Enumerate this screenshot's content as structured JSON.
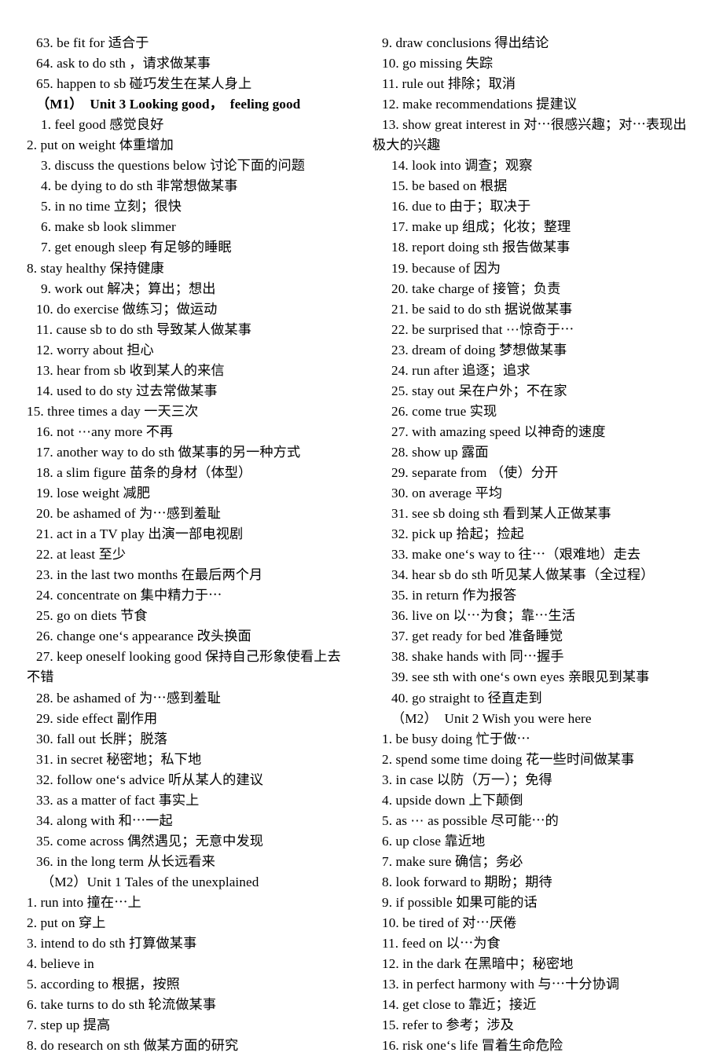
{
  "document": {
    "title": "English phrases study list",
    "left_column": [
      {
        "text": "63. be fit for 适合于",
        "indent": 2
      },
      {
        "text": "64. ask to do sth ，请求做某事",
        "indent": 2
      },
      {
        "text": "65. happen to sb 碰巧发生在某人身上",
        "indent": 2
      },
      {
        "text": "（M1）  Unit 3 Looking good，  feeling good",
        "indent": 2,
        "style": "header-bold"
      },
      {
        "text": "1. feel good 感觉良好",
        "indent": 3
      },
      {
        "text": "2. put on weight 体重增加",
        "indent": 0
      },
      {
        "text": "3. discuss the questions below 讨论下面的问题",
        "indent": 3
      },
      {
        "text": "4. be dying to do sth 非常想做某事",
        "indent": 3
      },
      {
        "text": "5. in no time 立刻；很快",
        "indent": 3
      },
      {
        "text": "6. make sb look slimmer",
        "indent": 3
      },
      {
        "text": "7. get enough sleep 有足够的睡眠",
        "indent": 3
      },
      {
        "text": "8. stay healthy 保持健康",
        "indent": 0
      },
      {
        "text": "9. work out 解决；算出；想出",
        "indent": 3
      },
      {
        "text": "10. do exercise 做练习；做运动",
        "indent": 2
      },
      {
        "text": "11. cause sb to do sth 导致某人做某事",
        "indent": 2
      },
      {
        "text": "12. worry about 担心",
        "indent": 2
      },
      {
        "text": "13. hear from sb 收到某人的来信",
        "indent": 2
      },
      {
        "text": "14. used to do sty 过去常做某事",
        "indent": 2
      },
      {
        "text": "15. three times a day 一天三次",
        "indent": 0
      },
      {
        "text": "16. not ⋯any more 不再",
        "indent": 2
      },
      {
        "text": "17. another way to do sth 做某事的另一种方式",
        "indent": 2
      },
      {
        "text": "18. a slim figure 苗条的身材（体型）",
        "indent": 2
      },
      {
        "text": "19. lose weight 减肥",
        "indent": 2
      },
      {
        "text": "20. be ashamed of 为⋯感到羞耻",
        "indent": 2
      },
      {
        "text": "21. act in a TV play 出演一部电视剧",
        "indent": 2
      },
      {
        "text": "22. at least 至少",
        "indent": 2
      },
      {
        "text": "23. in the last two months 在最后两个月",
        "indent": 2
      },
      {
        "text": "24. concentrate on 集中精力于⋯",
        "indent": 2
      },
      {
        "text": "25. go on diets 节食",
        "indent": 2
      },
      {
        "text": "26. change one‘s appearance 改头换面",
        "indent": 2
      },
      {
        "text": "27. keep oneself looking good 保持自己形象使看上去",
        "indent": 2
      },
      {
        "text": "不错",
        "indent": 0,
        "style": "wrap"
      },
      {
        "text": "28. be ashamed of 为⋯感到羞耻",
        "indent": 2
      },
      {
        "text": "29. side effect 副作用",
        "indent": 2
      },
      {
        "text": "30. fall out 长胖；脱落",
        "indent": 2
      },
      {
        "text": "31. in secret 秘密地；私下地",
        "indent": 2
      },
      {
        "text": "32. follow one‘s advice 听从某人的建议",
        "indent": 2
      },
      {
        "text": "33. as a matter of fact 事实上",
        "indent": 2
      },
      {
        "text": "34. along with 和⋯一起",
        "indent": 2
      },
      {
        "text": "35. come across 偶然遇见；无意中发现",
        "indent": 2
      },
      {
        "text": "36. in the long term 从长远看来",
        "indent": 2
      },
      {
        "text": "（M2）Unit 1 Tales of the unexplained",
        "indent": 3,
        "style": "header"
      },
      {
        "text": "1. run into 撞在⋯上",
        "indent": 0
      },
      {
        "text": "2. put on 穿上",
        "indent": 0
      },
      {
        "text": "3. intend to do sth 打算做某事",
        "indent": 0
      },
      {
        "text": "4. believe in",
        "indent": 0
      },
      {
        "text": "5. according to 根据，按照",
        "indent": 0
      },
      {
        "text": "6. take turns to do sth 轮流做某事",
        "indent": 0
      },
      {
        "text": "7. step up 提高",
        "indent": 0
      },
      {
        "text": "8. do research on sth 做某方面的研究",
        "indent": 0
      }
    ],
    "right_column": [
      {
        "text": "9. draw conclusions 得出结论",
        "indent": 2
      },
      {
        "text": "10. go missing 失踪",
        "indent": 2
      },
      {
        "text": "11. rule out 排除；取消",
        "indent": 2
      },
      {
        "text": "12. make recommendations 提建议",
        "indent": 2
      },
      {
        "text": "13. show great interest in 对⋯很感兴趣；对⋯表现出",
        "indent": 2
      },
      {
        "text": "极大的兴趣",
        "indent": 0,
        "style": "wrap"
      },
      {
        "text": "14. look into 调查；观察",
        "indent": 4
      },
      {
        "text": "15. be based on 根据",
        "indent": 4
      },
      {
        "text": "16. due to 由于；取决于",
        "indent": 4
      },
      {
        "text": "17. make up 组成；化妆；整理",
        "indent": 4
      },
      {
        "text": "18. report doing sth 报告做某事",
        "indent": 4
      },
      {
        "text": "19. because of 因为",
        "indent": 4
      },
      {
        "text": "20. take charge of 接管；负责",
        "indent": 4
      },
      {
        "text": "21. be said to do sth 据说做某事",
        "indent": 4
      },
      {
        "text": "22. be surprised that ⋯惊奇于⋯",
        "indent": 4
      },
      {
        "text": "23. dream of doing 梦想做某事",
        "indent": 4
      },
      {
        "text": "24. run after 追逐；追求",
        "indent": 4
      },
      {
        "text": "25. stay out 呆在户外；不在家",
        "indent": 4
      },
      {
        "text": "26. come true 实现",
        "indent": 4
      },
      {
        "text": "27. with amazing speed 以神奇的速度",
        "indent": 4
      },
      {
        "text": "28. show up 露面",
        "indent": 4
      },
      {
        "text": "29. separate from （使）分开",
        "indent": 4
      },
      {
        "text": "30. on average 平均",
        "indent": 4
      },
      {
        "text": "31. see sb doing sth 看到某人正做某事",
        "indent": 4
      },
      {
        "text": "32. pick up 拾起；捡起",
        "indent": 4
      },
      {
        "text": "33. make one‘s way to 往⋯（艰难地）走去",
        "indent": 4
      },
      {
        "text": "34. hear sb do sth 听见某人做某事（全过程）",
        "indent": 4
      },
      {
        "text": "35. in return 作为报答",
        "indent": 4
      },
      {
        "text": "36. live on 以⋯为食；靠⋯生活",
        "indent": 4
      },
      {
        "text": "37. get ready for bed 准备睡觉",
        "indent": 4
      },
      {
        "text": "38. shake hands with 同⋯握手",
        "indent": 4
      },
      {
        "text": "39. see sth with one‘s own eyes 亲眼见到某事",
        "indent": 4
      },
      {
        "text": "40. go straight to 径直走到",
        "indent": 4
      },
      {
        "text": "（M2）  Unit 2 Wish you were here",
        "indent": 4,
        "style": "header"
      },
      {
        "text": "1. be busy doing 忙于做⋯",
        "indent": 2
      },
      {
        "text": "2. spend some time doing 花一些时间做某事",
        "indent": 2
      },
      {
        "text": "3. in case 以防（万一）；免得",
        "indent": 2
      },
      {
        "text": "4. upside down 上下颠倒",
        "indent": 2
      },
      {
        "text": "5. as ⋯ as possible 尽可能⋯的",
        "indent": 2
      },
      {
        "text": "6. up close 靠近地",
        "indent": 2
      },
      {
        "text": "7. make sure 确信；务必",
        "indent": 2
      },
      {
        "text": "8. look forward to 期盼；期待",
        "indent": 2
      },
      {
        "text": "9. if possible 如果可能的话",
        "indent": 2
      },
      {
        "text": "10. be tired of 对⋯厌倦",
        "indent": 2
      },
      {
        "text": "11. feed on 以⋯为食",
        "indent": 2
      },
      {
        "text": "12. in the dark 在黑暗中；秘密地",
        "indent": 2
      },
      {
        "text": "13. in perfect harmony with 与⋯十分协调",
        "indent": 2
      },
      {
        "text": "14. get close to 靠近；接近",
        "indent": 2
      },
      {
        "text": "15. refer to 参考；涉及",
        "indent": 2
      },
      {
        "text": "16. risk one‘s life 冒着生命危险",
        "indent": 2
      }
    ]
  }
}
